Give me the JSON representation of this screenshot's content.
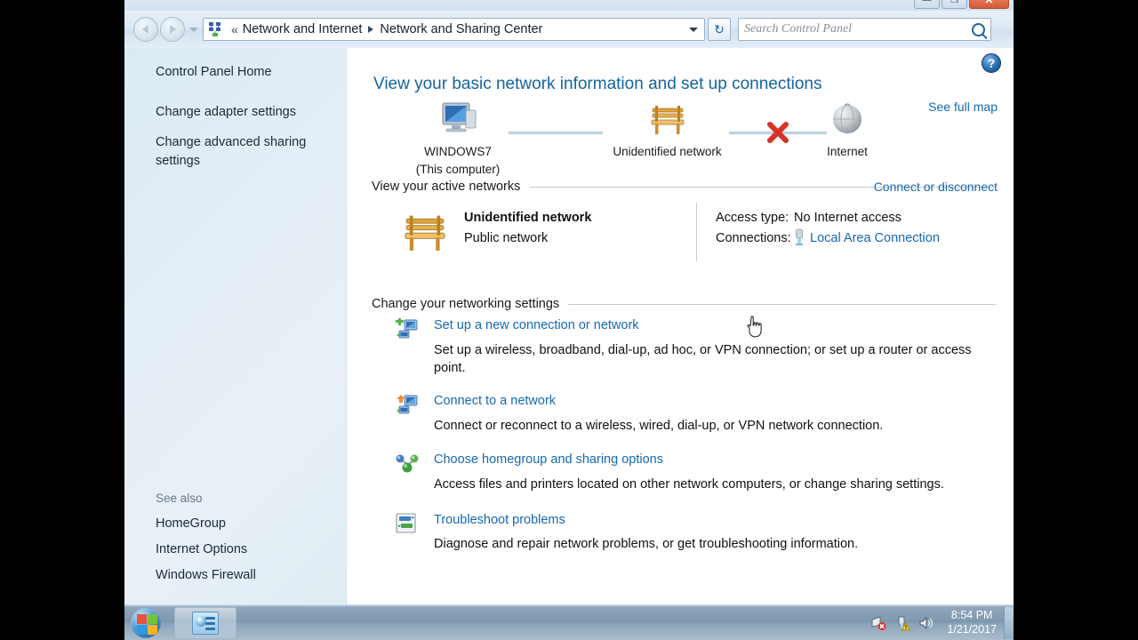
{
  "window": {
    "controls": [
      {
        "name": "minimize",
        "glyph": "—"
      },
      {
        "name": "restore",
        "glyph": "❐"
      },
      {
        "name": "close",
        "glyph": "✕"
      }
    ]
  },
  "nav": {
    "back_tooltip": "Back",
    "forward_tooltip": "Forward",
    "recent_pages_tooltip": "Recent Pages",
    "breadcrumb": {
      "icon": "network-breadcrumb-icon",
      "overflow": "«",
      "segments": [
        "Network and Internet",
        "Network and Sharing Center"
      ]
    },
    "refresh_glyph": "↻",
    "previous_locations_tooltip": "Previous Locations"
  },
  "search": {
    "placeholder": "Search Control Panel",
    "value": "",
    "icon": "search-icon"
  },
  "sidebar": {
    "home": "Control Panel Home",
    "links": [
      "Change adapter settings",
      "Change advanced sharing settings"
    ],
    "see_also_label": "See also",
    "see_also": [
      "HomeGroup",
      "Internet Options",
      "Windows Firewall"
    ]
  },
  "content": {
    "help_glyph": "?",
    "heading": "View your basic network information and set up connections",
    "see_full_map": "See full map",
    "network_map": {
      "nodes": [
        {
          "icon": "computer-icon",
          "label": "WINDOWS7",
          "sublabel": "(This computer)"
        },
        {
          "icon": "bench-network-icon",
          "label": "Unidentified network",
          "sublabel": ""
        },
        {
          "icon": "globe-icon",
          "label": "Internet",
          "sublabel": ""
        }
      ],
      "link_broken_marker": "red-x"
    },
    "active_networks": {
      "section_title": "View your active networks",
      "action_link": "Connect or disconnect",
      "network_name": "Unidentified network",
      "network_type": "Public network",
      "network_icon": "bench-network-icon",
      "details": [
        {
          "key": "Access type:",
          "value": "No Internet access",
          "is_link": false
        },
        {
          "key": "Connections:",
          "value": "Local Area Connection",
          "is_link": true,
          "icon": "ethernet-adapter-icon"
        }
      ]
    },
    "change_settings": {
      "section_title": "Change your networking settings",
      "tasks": [
        {
          "icon": "new-connection-icon",
          "title": "Set up a new connection or network",
          "description": "Set up a wireless, broadband, dial-up, ad hoc, or VPN connection; or set up a router or access point."
        },
        {
          "icon": "connect-network-icon",
          "title": "Connect to a network",
          "description": "Connect or reconnect to a wireless, wired, dial-up, or VPN network connection."
        },
        {
          "icon": "homegroup-icon",
          "title": "Choose homegroup and sharing options",
          "description": "Access files and printers located on other network computers, or change sharing settings."
        },
        {
          "icon": "troubleshoot-icon",
          "title": "Troubleshoot problems",
          "description": "Diagnose and repair network problems, or get troubleshooting information."
        }
      ]
    }
  },
  "taskbar": {
    "start_label": "Start",
    "items": [
      {
        "icon": "control-panel-icon",
        "label": "Control Panel"
      }
    ],
    "tray": [
      {
        "name": "network-error-icon"
      },
      {
        "name": "action-center-warning-icon"
      },
      {
        "name": "volume-icon"
      }
    ],
    "clock": {
      "time": "8:54 PM",
      "date": "1/21/2017"
    },
    "show_desktop_tooltip": "Show desktop"
  },
  "colors": {
    "link": "#1668b4",
    "heading": "#14649e",
    "sidebar_bg": "#e2edf5",
    "content_bg": "#ffffff",
    "error_red": "#d8332a"
  }
}
